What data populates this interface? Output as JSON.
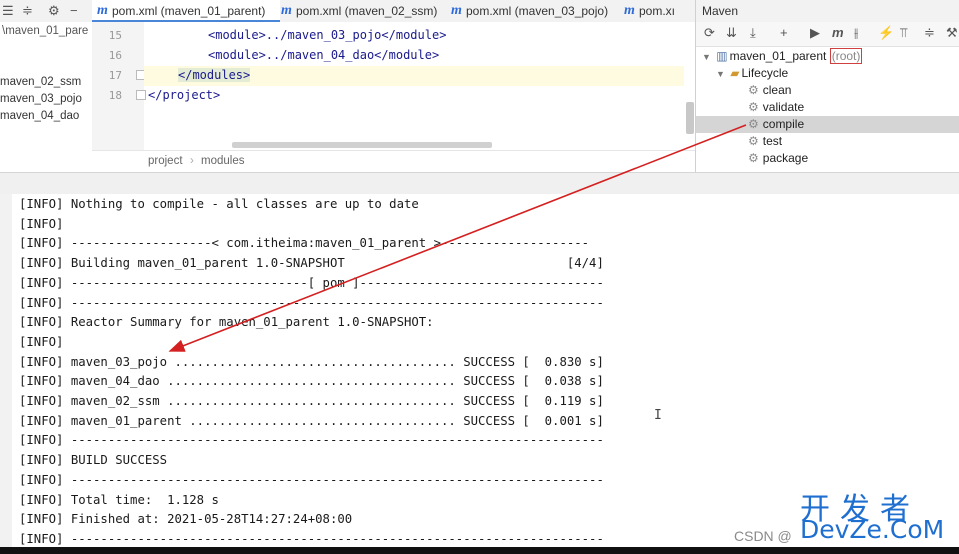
{
  "project_tree": {
    "path_fragment": "\\maven_01_pare",
    "items": [
      "maven_02_ssm",
      "maven_03_pojo",
      "maven_04_dao"
    ]
  },
  "left_toolbar": {
    "icons": [
      "collapse-all-icon",
      "divider-icon",
      "settings-icon",
      "minus-icon"
    ]
  },
  "tabs": [
    {
      "label": "pom.xml (maven_01_parent)",
      "active": true
    },
    {
      "label": "pom.xml (maven_02_ssm)",
      "active": false
    },
    {
      "label": "pom.xml (maven_03_pojo)",
      "active": false
    },
    {
      "label": "pom.xı",
      "active": false
    }
  ],
  "editor": {
    "lines": [
      {
        "num": "15",
        "text": "<module>../maven_03_pojo</module>"
      },
      {
        "num": "16",
        "text": "<module>../maven_04_dao</module>"
      },
      {
        "num": "17",
        "text": "</modules>"
      },
      {
        "num": "18",
        "text": "</project>"
      }
    ],
    "breadcrumb": [
      "project",
      "modules"
    ],
    "breadcrumb_sep": "›"
  },
  "maven": {
    "title": "Maven",
    "root_project": "maven_01_parent",
    "root_tag": "(root)",
    "lifecycle_label": "Lifecycle",
    "phases": [
      "clean",
      "validate",
      "compile",
      "test",
      "package"
    ],
    "selected_phase": "compile"
  },
  "console": {
    "lines": [
      "[INFO] Nothing to compile - all classes are up to date",
      "[INFO]",
      "[INFO] -------------------< com.itheima:maven_01_parent >--------------------",
      "[INFO] Building maven_01_parent 1.0-SNAPSHOT                              [4/4]",
      "[INFO] --------------------------------[ pom ]---------------------------------",
      "[INFO] ------------------------------------------------------------------------",
      "[INFO] Reactor Summary for maven_01_parent 1.0-SNAPSHOT:",
      "[INFO]",
      "[INFO] maven_03_pojo ...................................... SUCCESS [  0.830 s]",
      "[INFO] maven_04_dao ....................................... SUCCESS [  0.038 s]",
      "[INFO] maven_02_ssm ....................................... SUCCESS [  0.119 s]",
      "[INFO] maven_01_parent .................................... SUCCESS [  0.001 s]",
      "[INFO] ------------------------------------------------------------------------",
      "[INFO] BUILD SUCCESS",
      "[INFO] ------------------------------------------------------------------------",
      "[INFO] Total time:  1.128 s",
      "[INFO] Finished at: 2021-05-28T14:27:24+08:00",
      "[INFO] ------------------------------------------------------------------------"
    ]
  },
  "watermark": {
    "cn": "开发者",
    "en": "DevZe.CoM",
    "csdn": "CSDN @"
  },
  "colors": {
    "arrow": "#d42020",
    "accent": "#4a86d8",
    "watermark": "#1f6fd0"
  }
}
